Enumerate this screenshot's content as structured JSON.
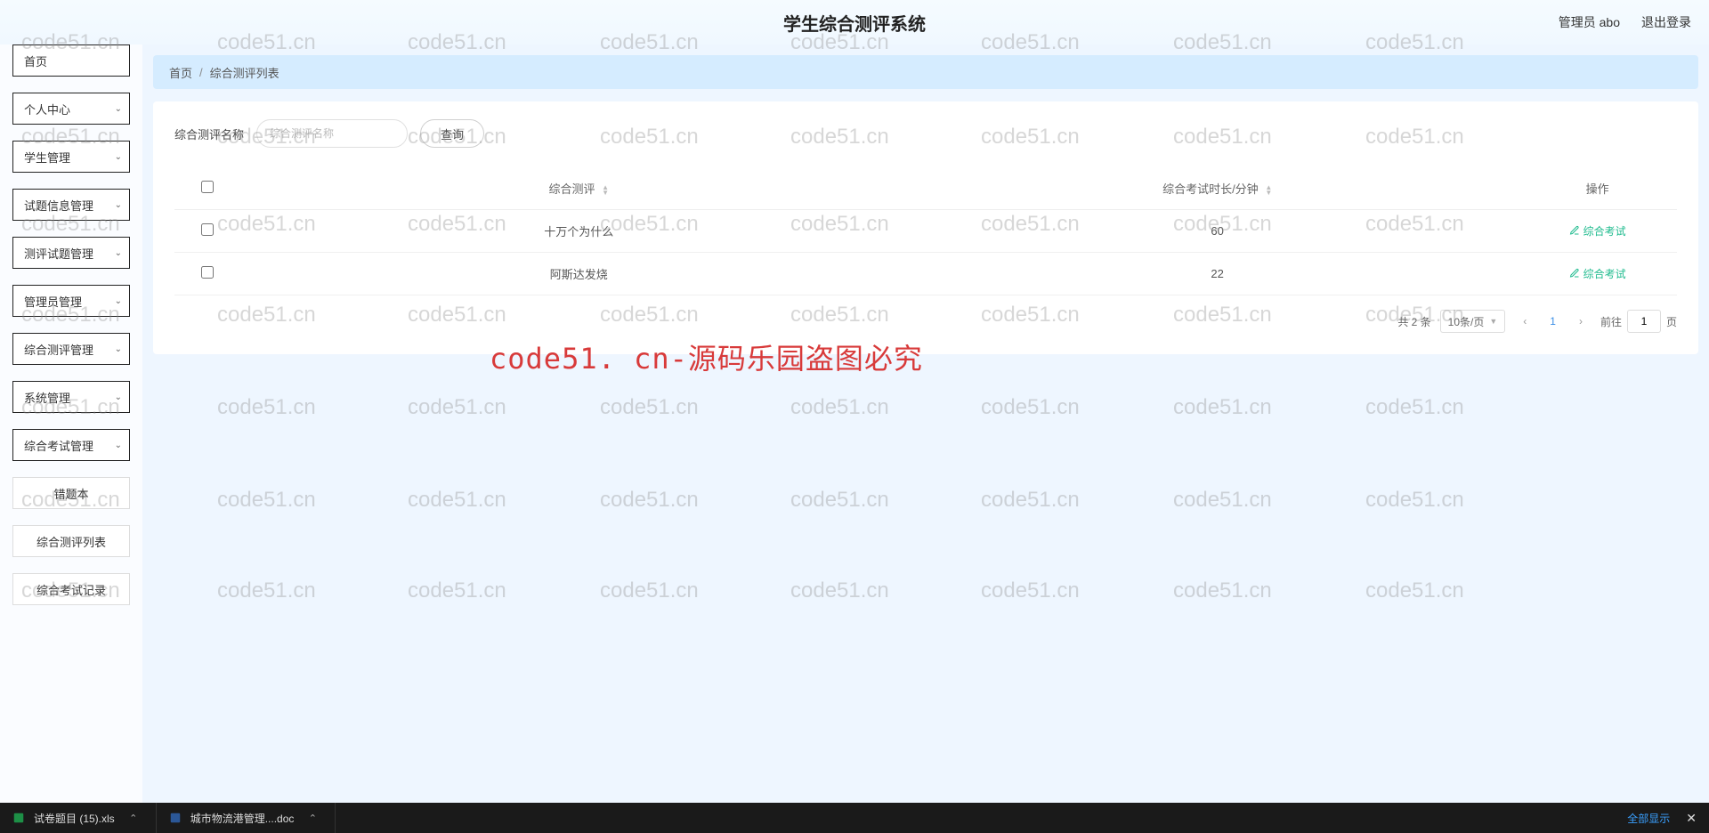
{
  "header": {
    "title": "学生综合测评系统",
    "admin_label": "管理员 abo",
    "logout_label": "退出登录"
  },
  "sidebar": {
    "items": [
      {
        "label": "首页",
        "expandable": false
      },
      {
        "label": "个人中心",
        "expandable": true
      },
      {
        "label": "学生管理",
        "expandable": true
      },
      {
        "label": "试题信息管理",
        "expandable": true
      },
      {
        "label": "测评试题管理",
        "expandable": true
      },
      {
        "label": "管理员管理",
        "expandable": true
      },
      {
        "label": "综合测评管理",
        "expandable": true
      },
      {
        "label": "系统管理",
        "expandable": true
      },
      {
        "label": "综合考试管理",
        "expandable": true
      },
      {
        "label": "错题本",
        "expandable": false,
        "simple": true
      },
      {
        "label": "综合测评列表",
        "expandable": false,
        "simple": true
      },
      {
        "label": "综合考试记录",
        "expandable": false,
        "simple": true
      }
    ]
  },
  "breadcrumb": {
    "home": "首页",
    "current": "综合测评列表"
  },
  "search": {
    "label": "综合测评名称",
    "placeholder": "综合测评名称",
    "button": "查询"
  },
  "table": {
    "columns": {
      "name": "综合测评",
      "duration": "综合考试时长/分钟",
      "action": "操作"
    },
    "action_label": "综合考试",
    "rows": [
      {
        "name": "十万个为什么",
        "duration": "60"
      },
      {
        "name": "阿斯达发烧",
        "duration": "22"
      }
    ]
  },
  "pagination": {
    "total_text": "共 2 条",
    "page_size": "10条/页",
    "current": "1",
    "jump_prefix": "前往",
    "jump_value": "1",
    "jump_suffix": "页"
  },
  "watermark": {
    "text": "code51.cn",
    "big": "code51. cn-源码乐园盗图必究"
  },
  "taskbar": {
    "files": [
      {
        "name": "试卷题目 (15).xls",
        "type": "xls"
      },
      {
        "name": "城市物流港管理....doc",
        "type": "doc"
      }
    ],
    "show_all": "全部显示"
  }
}
